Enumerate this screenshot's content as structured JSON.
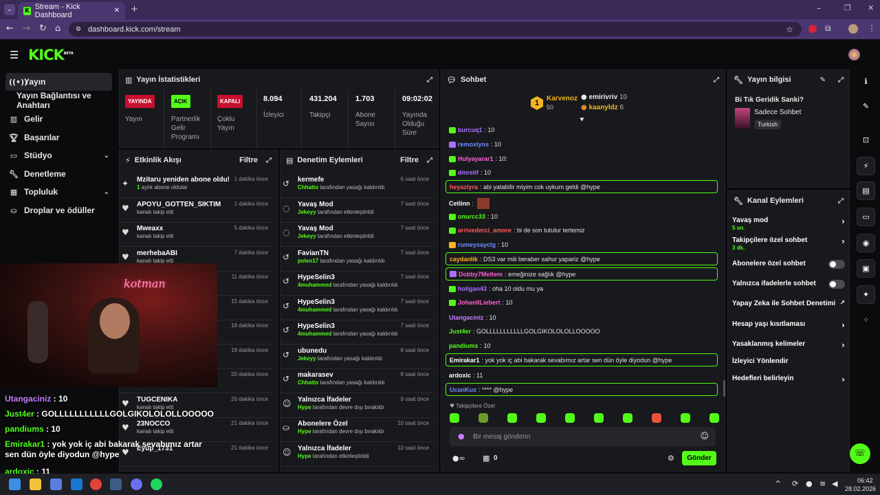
{
  "browser": {
    "tab_title": "Stream - Kick Dashboard",
    "url": "dashboard.kick.com/stream"
  },
  "logo": {
    "text": "KICK",
    "sup": "BETA"
  },
  "sidebar": {
    "items": [
      {
        "label": "Yayın",
        "icon": "broadcast-icon"
      },
      {
        "label": "Yayın Bağlantısı ve Anahtarı",
        "icon": ""
      },
      {
        "label": "Gelir",
        "icon": "chart-icon"
      },
      {
        "label": "Başarılar",
        "icon": "trophy-icon"
      },
      {
        "label": "Stüdyo",
        "icon": "studio-icon"
      },
      {
        "label": "Denetleme",
        "icon": "wrench-icon"
      },
      {
        "label": "Topluluk",
        "icon": "community-icon"
      },
      {
        "label": "Droplar ve ödüller",
        "icon": "gift-icon"
      }
    ]
  },
  "stats": {
    "title": "Yayın İstatistikleri",
    "items": [
      {
        "badge": "YAYINDA",
        "label": "Yayın",
        "badge_color": "#c8102e"
      },
      {
        "badge": "AÇIK",
        "label": "Partnerlik Gelir Programı",
        "badge_color": "#53fc18"
      },
      {
        "badge": "KAPALI",
        "label": "Çoklu Yayın",
        "badge_color": "#c8102e"
      },
      {
        "value": "8.094",
        "label": "İzleyici"
      },
      {
        "value": "431.204",
        "label": "Takipçi"
      },
      {
        "value": "1.703",
        "label": "Abone Sayısı"
      },
      {
        "value": "09:02:02",
        "label": "Yayında Olduğu Süre"
      }
    ]
  },
  "activity": {
    "title": "Etkinlik Akışı",
    "filter": "Filtre",
    "rows": [
      {
        "title": "Mzitaru yeniden abone oldu!",
        "sub_green": "1",
        "sub": " aylık abone oldular",
        "time": "1 dakika önce"
      },
      {
        "title": "APOYU_GOTTEN_SIKTIM",
        "sub": "kanalı takip etti",
        "time": "1 dakika önce"
      },
      {
        "title": "Mweaxx",
        "sub": "kanalı takip etti",
        "time": "5 dakika önce"
      },
      {
        "title": "merhebaABI",
        "sub": "kanalı takip etti",
        "time": "7 dakika önce"
      },
      {
        "title": "",
        "sub": "",
        "time": "11 dakika önce"
      },
      {
        "title": "",
        "sub": "",
        "time": "15 dakika önce"
      },
      {
        "title": "",
        "sub": "",
        "time": "18 dakika önce"
      },
      {
        "title": "",
        "sub": "",
        "time": "18 dakika önce"
      },
      {
        "title": "",
        "sub": "",
        "time": "20 dakika önce"
      },
      {
        "title": "TUGCENIKA",
        "sub": "kanalı takip etti",
        "time": "20 dakika önce"
      },
      {
        "title": "23NOCCO",
        "sub": "kanalı takip etti",
        "time": "21 dakika önce"
      },
      {
        "title": "Eyup_1731",
        "sub": "",
        "time": "21 dakika önce"
      }
    ]
  },
  "moderation": {
    "title": "Denetim Eylemleri",
    "filter": "Filtre",
    "rows": [
      {
        "title": "kermefe",
        "actor": "Chhatto",
        "sub": " tarafından yasağı kaldırıldı",
        "time": "6 saat önce"
      },
      {
        "title": "Yavaş Mod",
        "actor": "Jekeyy",
        "sub": " tarafından etkinleştirildi",
        "time": "7 saat önce"
      },
      {
        "title": "Yavaş Mod",
        "actor": "Jekeyy",
        "sub": " tarafından etkinleştirildi",
        "time": "7 saat önce"
      },
      {
        "title": "FavianTN",
        "actor": "polen17",
        "sub": " tarafından yasağı kaldırıldı",
        "time": "7 saat önce"
      },
      {
        "title": "HypeSelin3",
        "actor": "4muhammed",
        "sub": " tarafından yasağı kaldırıldı",
        "time": "7 saat önce"
      },
      {
        "title": "HypeSelin3",
        "actor": "4muhammed",
        "sub": " tarafından yasağı kaldırıldı",
        "time": "7 saat önce"
      },
      {
        "title": "HypeSelin3",
        "actor": "4muhammed",
        "sub": " tarafından yasağı kaldırıldı",
        "time": "7 saat önce"
      },
      {
        "title": "ubunedu",
        "actor": "Jekeyy",
        "sub": " tarafından yasağı kaldırıldı",
        "time": "8 saat önce"
      },
      {
        "title": "makarasev",
        "actor": "Chhatto",
        "sub": " tarafından yasağı kaldırıldı",
        "time": "8 saat önce"
      },
      {
        "title": "Yalnızca İfadeler",
        "actor": "Hype",
        "sub": " tarafından devre dışı bırakıldı",
        "time": "9 saat önce"
      },
      {
        "title": "Abonelere Özel",
        "actor": "Hype",
        "sub": " tarafından devre dışı bırakıldı",
        "time": "10 saat önce"
      },
      {
        "title": "Yalnızca İfadeler",
        "actor": "Hype",
        "sub": " tarafından etkinleştirildi",
        "time": "10 saat önce"
      }
    ]
  },
  "chat": {
    "title": "Sohbet",
    "leader": {
      "name": "Karvenoz",
      "points": "50",
      "rank": "1"
    },
    "runners": [
      {
        "name": "emirivriv",
        "points": "10"
      },
      {
        "name": "kaanyldz",
        "points": "6"
      }
    ],
    "messages": [
      {
        "user": "burcuq1",
        "text": ": 10",
        "color": "#a970ff",
        "hl": false
      },
      {
        "user": "remoxiyos",
        "text": ": 10",
        "color": "#6d8bff",
        "hl": false
      },
      {
        "user": "Hulyayarar1",
        "text": ": 10:",
        "color": "#ff5fd2",
        "hl": false
      },
      {
        "user": "dmrelif",
        "text": ": 10",
        "color": "#a970ff",
        "hl": false
      },
      {
        "user": "heyaziyra",
        "text": ": abi yatabilir miyim cok uykum geldi @hype",
        "color": "#ff5a5a",
        "hl": true
      },
      {
        "user": "Cetiinn",
        "text": ":",
        "color": "#ffffff",
        "hl": false
      },
      {
        "user": "onurcc33",
        "text": ": 10",
        "color": "#53fc18",
        "hl": false
      },
      {
        "user": "arrivederci_amore",
        "text": ": bi de son tutulur tertemiz",
        "color": "#ff5a5a",
        "hl": false
      },
      {
        "user": "rumeysayclg",
        "text": ": 10",
        "color": "#6d8bff",
        "hl": false
      },
      {
        "user": "caydanlik",
        "text": ": DS3 var miii beraber sahur yapariz @hype",
        "color": "#ffb020",
        "hl": true
      },
      {
        "user": "Dobby7Meltem",
        "text": ": emeğinize sağlık @hype",
        "color": "#ff5fd2",
        "hl": true
      },
      {
        "user": "holigan43",
        "text": ": oha 10 oldu mu ya",
        "color": "#a970ff",
        "hl": false
      },
      {
        "user": "JohanIILiebert",
        "text": ": 10",
        "color": "#ff5fd2",
        "hl": false
      },
      {
        "user": "Utangaciniz",
        "text": ": 10",
        "color": "#c77dff",
        "hl": false
      },
      {
        "user": "Just4er",
        "text": ": GOLLLLLLLLLLLGOLGIKOLOLOLLOOOOO",
        "color": "#53fc18",
        "hl": false
      },
      {
        "user": "pandiums",
        "text": ": 10",
        "color": "#53fc18",
        "hl": false
      },
      {
        "user": "Emirakar1",
        "text": ": yok yok iç abi bakarak sevabımız artar sen dün öyle diyodun @hype",
        "color": "#ffffff",
        "hl": true
      },
      {
        "user": "ardoxic",
        "text": ": 11",
        "color": "#ffffff",
        "hl": false
      },
      {
        "user": "UcanKus",
        "text": ": **** @hype",
        "color": "#6d8bff",
        "hl": true
      }
    ],
    "followers_only_label": "Takipçilere Özel",
    "input_placeholder": "Bir mesaj gönderin",
    "count": "0",
    "send_label": "Gönder"
  },
  "stream_info": {
    "title": "Yayın bilgisi",
    "stream_title": "Bi Tık Geridik Sanki?",
    "category": "Sadece Sohbet",
    "language": "Turkish"
  },
  "channel_actions": {
    "title": "Kanal Eylemleri",
    "rows": [
      {
        "label": "Yavaş mod",
        "sub": "5 sn.",
        "control": "arrow"
      },
      {
        "label": "Takipçilere özel sohbet",
        "sub": "3 dk.",
        "control": "arrow"
      },
      {
        "label": "Abonelere özel sohbet",
        "sub": "",
        "control": "toggle"
      },
      {
        "label": "Yalnızca ifadelerle sohbet",
        "sub": "",
        "control": "toggle"
      },
      {
        "label": "Yapay Zeka ile Sohbet Denetimi",
        "sub": "",
        "control": "external"
      },
      {
        "label": "Hesap yaşı kısıtlaması",
        "sub": "",
        "control": "arrow"
      },
      {
        "label": "Yasaklanmış kelimeler",
        "sub": "",
        "control": "arrow"
      },
      {
        "label": "İzleyici Yönlendir",
        "sub": "",
        "control": "none"
      },
      {
        "label": "Hedefleri belirleyin",
        "sub": "",
        "control": "arrow"
      }
    ]
  },
  "webcam_overlay": [
    {
      "user": "Utangaciniz",
      "text": " : 10",
      "color": "#c77dff"
    },
    {
      "user": "Just4er",
      "text": " : GOLLLLLLLLLLLGOLGIKOLOLOLLOOOOO",
      "color": "#53fc18"
    },
    {
      "user": "pandiums",
      "text": " : 10",
      "color": "#53fc18"
    },
    {
      "user": "Emirakar1",
      "text": " : yok yok iç abi bakarak sevabımız artar sen dün öyle diyodun @hype",
      "color": "#53fc18"
    },
    {
      "user": "ardoxic",
      "text": " : 11",
      "color": "#53fc18"
    }
  ],
  "taskbar": {
    "time": "06:42",
    "date": "28.02.2026"
  },
  "colors": {
    "accent": "#53fc18",
    "panel": "#18191c",
    "live_red": "#c8102e"
  }
}
